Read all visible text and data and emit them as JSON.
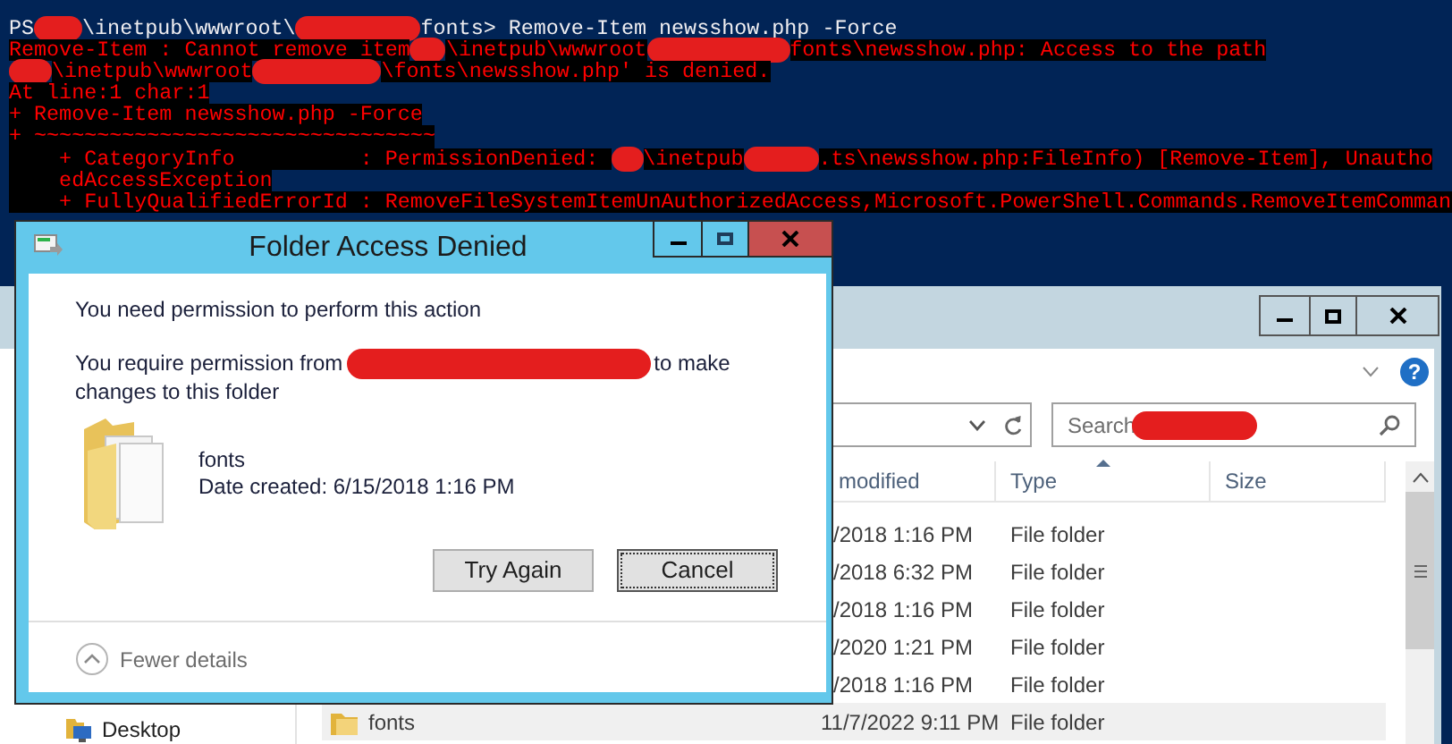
{
  "console": {
    "lines": [
      {
        "kind": "command",
        "segments": [
          {
            "kind": "text",
            "text": "PS"
          },
          {
            "kind": "redaction"
          },
          {
            "kind": "text",
            "text": "\\inetpub\\wwwroot\\"
          },
          {
            "kind": "redaction"
          },
          {
            "kind": "text",
            "text": "fonts> Remove-Item newsshow.php -Force"
          }
        ]
      },
      {
        "kind": "error",
        "segments": [
          {
            "kind": "text",
            "text": "Remove-Item : Cannot remove item"
          },
          {
            "kind": "redaction"
          },
          {
            "kind": "text",
            "text": "\\inetpub\\wwwroot"
          },
          {
            "kind": "redaction"
          },
          {
            "kind": "text",
            "text": "fonts\\newsshow.php: Access to the path"
          }
        ]
      },
      {
        "kind": "error",
        "segments": [
          {
            "kind": "redaction"
          },
          {
            "kind": "text",
            "text": "\\inetpub\\wwwroot"
          },
          {
            "kind": "redaction"
          },
          {
            "kind": "text",
            "text": "\\fonts\\newsshow.php' is denied."
          }
        ]
      },
      {
        "kind": "error",
        "segments": [
          {
            "kind": "text",
            "text": "At line:1 char:1"
          }
        ]
      },
      {
        "kind": "error",
        "segments": [
          {
            "kind": "text",
            "text": "+ Remove-Item newsshow.php -Force"
          }
        ]
      },
      {
        "kind": "error",
        "segments": [
          {
            "kind": "text",
            "text": "+ ~~~~~~~~~~~~~~~~~~~~~~~~~~~~~~~~"
          }
        ]
      },
      {
        "kind": "error",
        "segments": [
          {
            "kind": "text",
            "text": "    + CategoryInfo          : PermissionDenied: "
          },
          {
            "kind": "redaction"
          },
          {
            "kind": "text",
            "text": "\\inetpub"
          },
          {
            "kind": "redaction"
          },
          {
            "kind": "text",
            "text": ".ts\\newsshow.php:FileInfo) [Remove-Item], Unautho"
          }
        ]
      },
      {
        "kind": "error",
        "segments": [
          {
            "kind": "text",
            "text": "    edAccessException"
          }
        ]
      },
      {
        "kind": "error",
        "segments": [
          {
            "kind": "text",
            "text": "    + FullyQualifiedErrorId : RemoveFileSystemItemUnAuthorizedAccess,Microsoft.PowerShell.Commands.RemoveItemComman"
          }
        ]
      }
    ]
  },
  "explorer": {
    "help": "?",
    "search": {
      "segments": [
        {
          "kind": "text",
          "text": "Search"
        },
        {
          "kind": "redaction"
        }
      ]
    },
    "columns": [
      {
        "label": "modified"
      },
      {
        "label": "Type",
        "sorted": true
      },
      {
        "label": "Size"
      }
    ],
    "rows": [
      {
        "date": "/2018 1:16 PM",
        "type": "File folder",
        "selected": false
      },
      {
        "date": "/2018 6:32 PM",
        "type": "File folder",
        "selected": false
      },
      {
        "date": "/2018 1:16 PM",
        "type": "File folder",
        "selected": false
      },
      {
        "date": "/2020 1:21 PM",
        "type": "File folder",
        "selected": false
      },
      {
        "date": "/2018 1:16 PM",
        "type": "File folder",
        "selected": false
      },
      {
        "name": "fonts",
        "date": "11/7/2022 9:11 PM",
        "type": "File folder",
        "selected": true
      }
    ],
    "nav": [
      {
        "label": "Desktop"
      }
    ]
  },
  "dialog": {
    "title": "Folder Access Denied",
    "heading": "You need permission to perform this action",
    "message_line": [
      {
        "kind": "text",
        "text": "You require permission from"
      },
      {
        "kind": "redaction"
      },
      {
        "kind": "text",
        "text": "to make"
      }
    ],
    "message_line_2": "changes to this folder",
    "item": {
      "name": "fonts",
      "detail": "Date created: 6/15/2018 1:16 PM"
    },
    "buttons": [
      {
        "label": "Try Again",
        "focused": false
      },
      {
        "label": "Cancel",
        "focused": true
      }
    ],
    "details_toggle": "Fewer details"
  }
}
